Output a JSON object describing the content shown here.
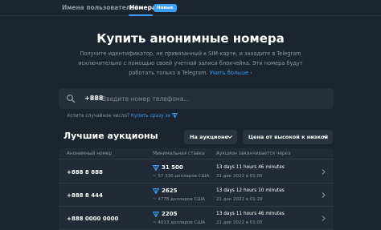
{
  "nav": {
    "tabs": [
      {
        "label": "Имена пользователей"
      },
      {
        "label": "Номера",
        "badge": "Новые"
      }
    ]
  },
  "hero": {
    "title": "Купить анонимные номера",
    "desc_line1": "Получите идентификатор, не привязанный к SIM-карте, и заходите в Telegram",
    "desc_line2": "исключительно с помощью своей учетной записи блокчейна. Эти номера будут",
    "desc_line3": "работать только в Telegram.",
    "learn_more": "Учить больше"
  },
  "search": {
    "prefix": "+888",
    "placeholder": "Введите номер телефона..."
  },
  "hint": {
    "text": "Хотите случайное число?",
    "link": "Купить сразу за"
  },
  "auctions": {
    "title": "Лучшие аукционы",
    "filter": "На аукционе",
    "sort": "Цена от высокой к низкой",
    "columns": [
      "Анонимный номер",
      "Минимальная ставка",
      "Аукцион заканчивается через"
    ],
    "rows": [
      {
        "number": "+888 8 888",
        "price": "31 500",
        "usd": "~ 57 330 долларов США",
        "time": "13 days 11 hours 46 minutes",
        "date": "21 дек 2022 в 01:05"
      },
      {
        "number": "+888 8 444",
        "price": "2625",
        "usd": "~ 4778 долларов США",
        "time": "13 days 12 hours 10 minutes",
        "date": "21 дек 2022 в 01:29"
      },
      {
        "number": "+888 0000 0000",
        "price": "2205",
        "usd": "~ 4013 долларов США",
        "time": "13 days 11 hours 46 minutes",
        "date": "21 дек 2022 в 01:05"
      }
    ]
  },
  "colors": {
    "background": "#1c242f",
    "accent": "#3c9ef5",
    "muted": "#8d98a6"
  },
  "icons": [
    "search-icon",
    "ton-icon",
    "chevron-down-icon",
    "chevron-right-icon"
  ]
}
